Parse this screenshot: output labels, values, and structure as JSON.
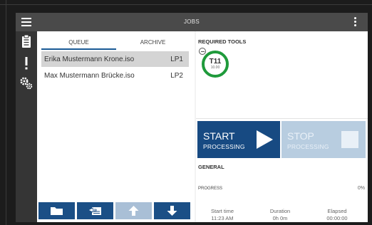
{
  "topbar": {
    "title": "JOBS"
  },
  "tabs": [
    {
      "label": "QUEUE"
    },
    {
      "label": "ARCHIVE"
    }
  ],
  "queue": [
    {
      "name": "Erika Mustermann Krone.iso",
      "slot": "LP1",
      "selected": true
    },
    {
      "name": "Max Mustermann Brücke.iso",
      "slot": "LP2",
      "selected": false
    }
  ],
  "required_tools": {
    "label": "REQUIRED TOOLS",
    "tool": {
      "name": "T11",
      "sub": "10.00"
    }
  },
  "actions": {
    "start": {
      "label": "START",
      "sub": "PROCESSING"
    },
    "stop": {
      "label": "STOP",
      "sub": "PROCESSING"
    }
  },
  "general": {
    "label": "GENERAL",
    "progress_label": "PROGRESS",
    "progress_value": "0%",
    "progress_fraction": 0,
    "start_time_label": "Start time",
    "start_time": "11:23 AM",
    "duration_label": "Duration",
    "duration": "0h 0m",
    "elapsed_label": "Elapsed",
    "elapsed": "00:00:00"
  },
  "colors": {
    "accent": "#174a82",
    "tool_ring": "#1f9a3b",
    "selected_row": "#d4d4d4",
    "topbar": "#4a4a4a",
    "sidebar": "#353535"
  },
  "icons": {
    "menu": "hamburger-icon",
    "more": "kebab-icon",
    "sidebar": [
      "clipboard-icon",
      "alert-icon",
      "gears-icon"
    ],
    "toolbar": [
      "folder-icon",
      "import-icon",
      "arrow-up-icon",
      "arrow-down-icon"
    ],
    "start": "play-icon",
    "stop": "stop-icon"
  }
}
